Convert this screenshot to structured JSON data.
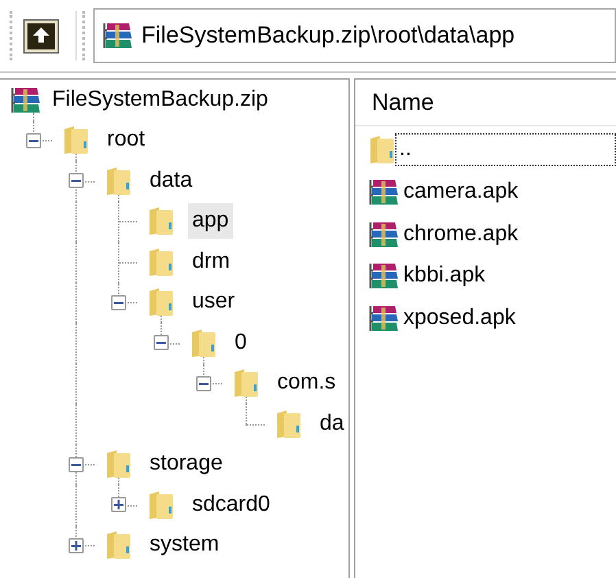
{
  "address_bar": {
    "path": "FileSystemBackup.zip\\root\\data\\app"
  },
  "tree": [
    {
      "label": "FileSystemBackup.zip",
      "kind": "archive",
      "selected": false,
      "children": [
        {
          "label": "root",
          "kind": "folder",
          "expanded": true,
          "selected": false,
          "children": [
            {
              "label": "data",
              "kind": "folder",
              "expanded": true,
              "selected": false,
              "children": [
                {
                  "label": "app",
                  "kind": "folder",
                  "selected": true
                },
                {
                  "label": "drm",
                  "kind": "folder",
                  "selected": false
                },
                {
                  "label": "user",
                  "kind": "folder",
                  "expanded": true,
                  "selected": false,
                  "children": [
                    {
                      "label": "0",
                      "kind": "folder",
                      "expanded": true,
                      "selected": false,
                      "children": [
                        {
                          "label": "com.s",
                          "kind": "folder",
                          "expanded": true,
                          "selected": false,
                          "children": [
                            {
                              "label": "da",
                              "kind": "folder",
                              "selected": false
                            }
                          ]
                        }
                      ]
                    }
                  ]
                }
              ]
            },
            {
              "label": "storage",
              "kind": "folder",
              "expanded": true,
              "selected": false,
              "children": [
                {
                  "label": "sdcard0",
                  "kind": "folder",
                  "expanded": false,
                  "selected": false
                }
              ]
            },
            {
              "label": "system",
              "kind": "folder",
              "expanded": false,
              "selected": false
            }
          ]
        }
      ]
    }
  ],
  "file_list": {
    "columns": [
      "Name"
    ],
    "rows": [
      {
        "name": "..",
        "kind": "folder",
        "focused": true
      },
      {
        "name": "camera.apk",
        "kind": "archive",
        "focused": false
      },
      {
        "name": "chrome.apk",
        "kind": "archive",
        "focused": false
      },
      {
        "name": "kbbi.apk",
        "kind": "archive",
        "focused": false
      },
      {
        "name": "xposed.apk",
        "kind": "archive",
        "focused": false
      }
    ]
  }
}
